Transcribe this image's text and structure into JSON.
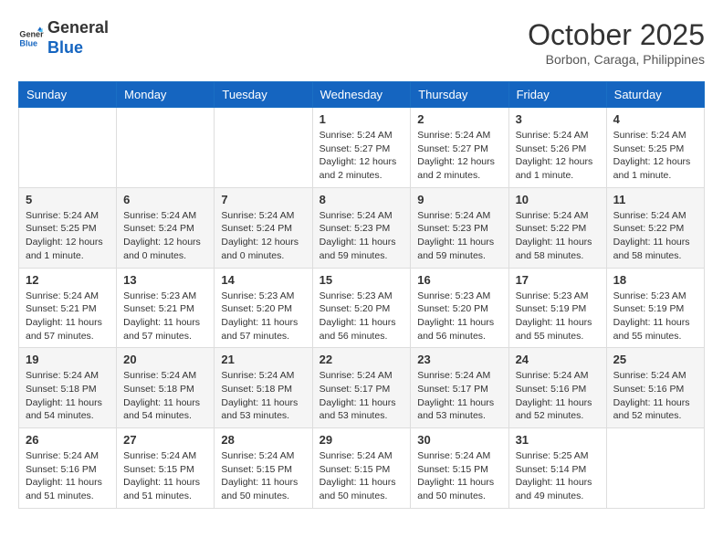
{
  "logo": {
    "text_general": "General",
    "text_blue": "Blue"
  },
  "header": {
    "month": "October 2025",
    "location": "Borbon, Caraga, Philippines"
  },
  "days_of_week": [
    "Sunday",
    "Monday",
    "Tuesday",
    "Wednesday",
    "Thursday",
    "Friday",
    "Saturday"
  ],
  "weeks": [
    [
      {
        "day": "",
        "info": ""
      },
      {
        "day": "",
        "info": ""
      },
      {
        "day": "",
        "info": ""
      },
      {
        "day": "1",
        "info": "Sunrise: 5:24 AM\nSunset: 5:27 PM\nDaylight: 12 hours and 2 minutes."
      },
      {
        "day": "2",
        "info": "Sunrise: 5:24 AM\nSunset: 5:27 PM\nDaylight: 12 hours and 2 minutes."
      },
      {
        "day": "3",
        "info": "Sunrise: 5:24 AM\nSunset: 5:26 PM\nDaylight: 12 hours and 1 minute."
      },
      {
        "day": "4",
        "info": "Sunrise: 5:24 AM\nSunset: 5:25 PM\nDaylight: 12 hours and 1 minute."
      }
    ],
    [
      {
        "day": "5",
        "info": "Sunrise: 5:24 AM\nSunset: 5:25 PM\nDaylight: 12 hours and 1 minute."
      },
      {
        "day": "6",
        "info": "Sunrise: 5:24 AM\nSunset: 5:24 PM\nDaylight: 12 hours and 0 minutes."
      },
      {
        "day": "7",
        "info": "Sunrise: 5:24 AM\nSunset: 5:24 PM\nDaylight: 12 hours and 0 minutes."
      },
      {
        "day": "8",
        "info": "Sunrise: 5:24 AM\nSunset: 5:23 PM\nDaylight: 11 hours and 59 minutes."
      },
      {
        "day": "9",
        "info": "Sunrise: 5:24 AM\nSunset: 5:23 PM\nDaylight: 11 hours and 59 minutes."
      },
      {
        "day": "10",
        "info": "Sunrise: 5:24 AM\nSunset: 5:22 PM\nDaylight: 11 hours and 58 minutes."
      },
      {
        "day": "11",
        "info": "Sunrise: 5:24 AM\nSunset: 5:22 PM\nDaylight: 11 hours and 58 minutes."
      }
    ],
    [
      {
        "day": "12",
        "info": "Sunrise: 5:24 AM\nSunset: 5:21 PM\nDaylight: 11 hours and 57 minutes."
      },
      {
        "day": "13",
        "info": "Sunrise: 5:23 AM\nSunset: 5:21 PM\nDaylight: 11 hours and 57 minutes."
      },
      {
        "day": "14",
        "info": "Sunrise: 5:23 AM\nSunset: 5:20 PM\nDaylight: 11 hours and 57 minutes."
      },
      {
        "day": "15",
        "info": "Sunrise: 5:23 AM\nSunset: 5:20 PM\nDaylight: 11 hours and 56 minutes."
      },
      {
        "day": "16",
        "info": "Sunrise: 5:23 AM\nSunset: 5:20 PM\nDaylight: 11 hours and 56 minutes."
      },
      {
        "day": "17",
        "info": "Sunrise: 5:23 AM\nSunset: 5:19 PM\nDaylight: 11 hours and 55 minutes."
      },
      {
        "day": "18",
        "info": "Sunrise: 5:23 AM\nSunset: 5:19 PM\nDaylight: 11 hours and 55 minutes."
      }
    ],
    [
      {
        "day": "19",
        "info": "Sunrise: 5:24 AM\nSunset: 5:18 PM\nDaylight: 11 hours and 54 minutes."
      },
      {
        "day": "20",
        "info": "Sunrise: 5:24 AM\nSunset: 5:18 PM\nDaylight: 11 hours and 54 minutes."
      },
      {
        "day": "21",
        "info": "Sunrise: 5:24 AM\nSunset: 5:18 PM\nDaylight: 11 hours and 53 minutes."
      },
      {
        "day": "22",
        "info": "Sunrise: 5:24 AM\nSunset: 5:17 PM\nDaylight: 11 hours and 53 minutes."
      },
      {
        "day": "23",
        "info": "Sunrise: 5:24 AM\nSunset: 5:17 PM\nDaylight: 11 hours and 53 minutes."
      },
      {
        "day": "24",
        "info": "Sunrise: 5:24 AM\nSunset: 5:16 PM\nDaylight: 11 hours and 52 minutes."
      },
      {
        "day": "25",
        "info": "Sunrise: 5:24 AM\nSunset: 5:16 PM\nDaylight: 11 hours and 52 minutes."
      }
    ],
    [
      {
        "day": "26",
        "info": "Sunrise: 5:24 AM\nSunset: 5:16 PM\nDaylight: 11 hours and 51 minutes."
      },
      {
        "day": "27",
        "info": "Sunrise: 5:24 AM\nSunset: 5:15 PM\nDaylight: 11 hours and 51 minutes."
      },
      {
        "day": "28",
        "info": "Sunrise: 5:24 AM\nSunset: 5:15 PM\nDaylight: 11 hours and 50 minutes."
      },
      {
        "day": "29",
        "info": "Sunrise: 5:24 AM\nSunset: 5:15 PM\nDaylight: 11 hours and 50 minutes."
      },
      {
        "day": "30",
        "info": "Sunrise: 5:24 AM\nSunset: 5:15 PM\nDaylight: 11 hours and 50 minutes."
      },
      {
        "day": "31",
        "info": "Sunrise: 5:25 AM\nSunset: 5:14 PM\nDaylight: 11 hours and 49 minutes."
      },
      {
        "day": "",
        "info": ""
      }
    ]
  ]
}
